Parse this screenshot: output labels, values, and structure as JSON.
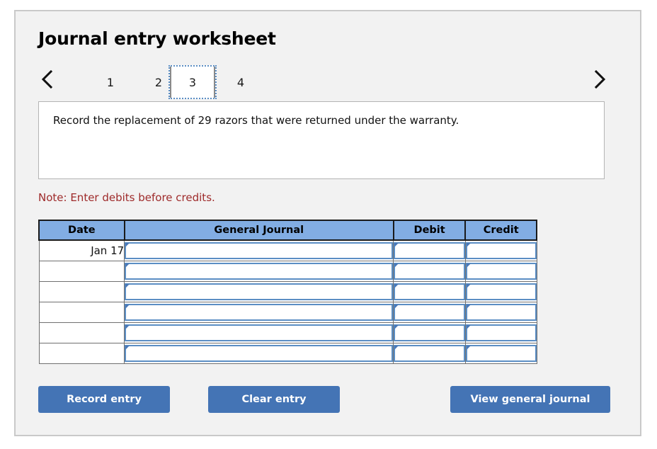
{
  "worksheet": {
    "title": "Journal entry worksheet",
    "prev_arrow_icon": "chevron-left-icon",
    "next_arrow_icon": "chevron-right-icon",
    "tabs": [
      {
        "label": "1",
        "selected": false
      },
      {
        "label": "2",
        "selected": false
      },
      {
        "label": "3",
        "selected": true
      },
      {
        "label": "4",
        "selected": false
      }
    ],
    "description": "Record the replacement of 29 razors that were returned under the warranty.",
    "note": "Note: Enter debits before credits."
  },
  "journal": {
    "columns": [
      "Date",
      "General Journal",
      "Debit",
      "Credit"
    ],
    "rows": [
      {
        "date": "Jan 17",
        "general_journal": "",
        "debit": "",
        "credit": ""
      },
      {
        "date": "",
        "general_journal": "",
        "debit": "",
        "credit": ""
      },
      {
        "date": "",
        "general_journal": "",
        "debit": "",
        "credit": ""
      },
      {
        "date": "",
        "general_journal": "",
        "debit": "",
        "credit": ""
      },
      {
        "date": "",
        "general_journal": "",
        "debit": "",
        "credit": ""
      },
      {
        "date": "",
        "general_journal": "",
        "debit": "",
        "credit": ""
      }
    ]
  },
  "actions": {
    "record_entry": "Record entry",
    "clear_entry": "Clear entry",
    "view_general_journal": "View general journal"
  },
  "colors": {
    "panel_background": "#f2f2f2",
    "panel_border": "#c9c9c9",
    "table_header": "#82ade3",
    "button_blue": "#4474b5",
    "note_red": "#9e2a2a",
    "input_border_blue": "#5b8ec4"
  }
}
